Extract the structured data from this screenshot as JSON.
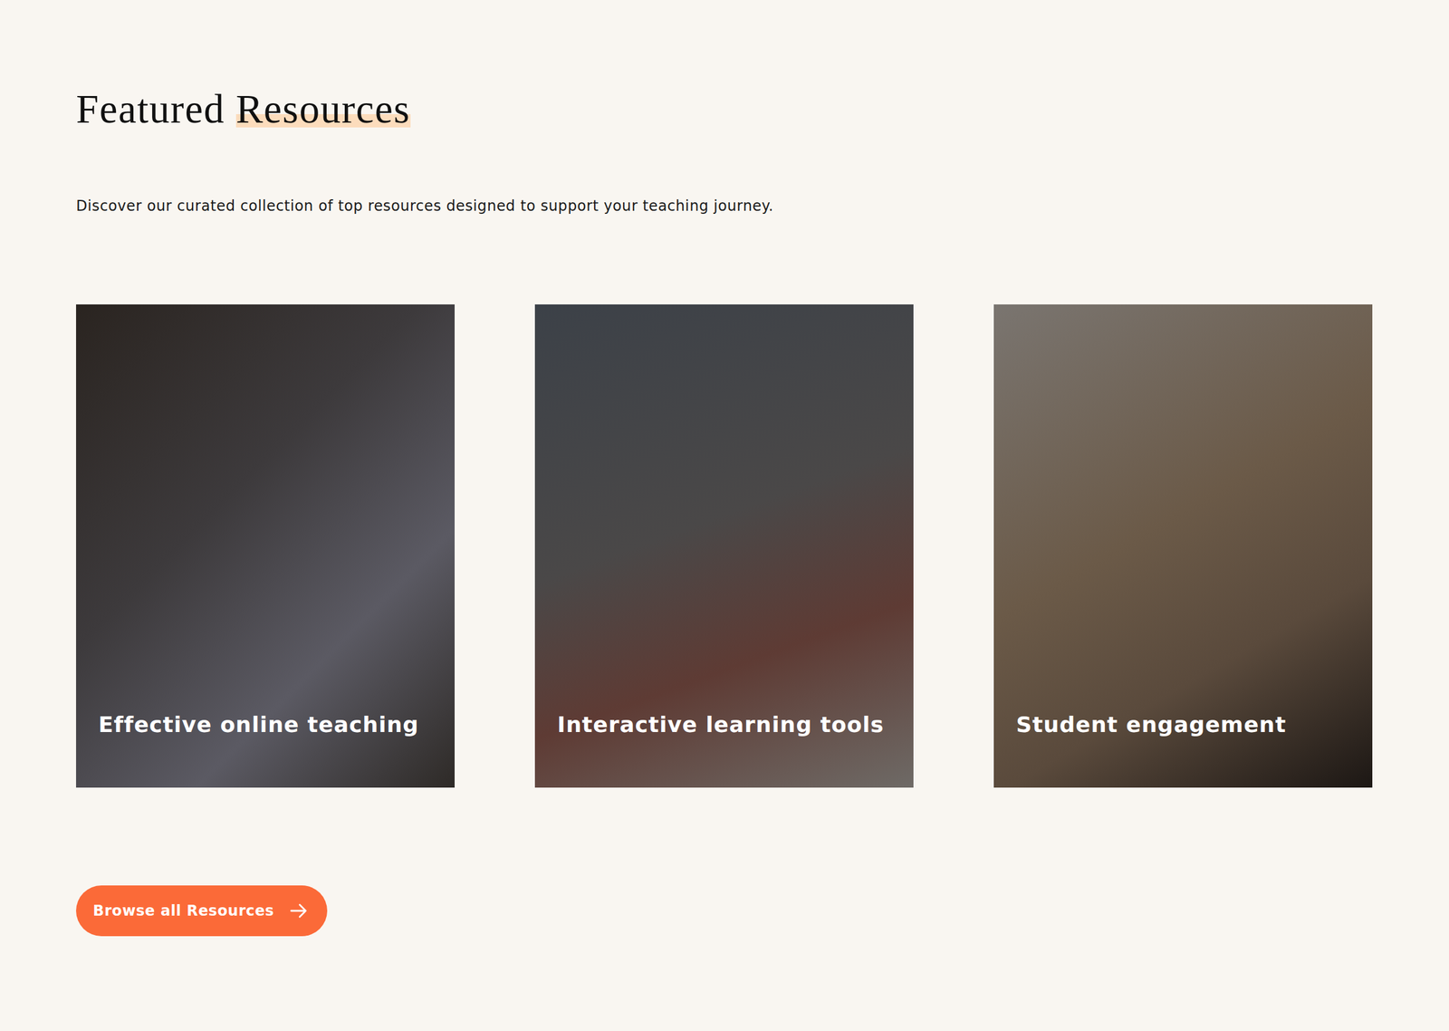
{
  "section": {
    "title": "Featured",
    "title_highlight": "Resources",
    "subtitle": "Discover our curated collection of top resources designed to support your teaching journey."
  },
  "cards": [
    {
      "title": "Effective online teaching"
    },
    {
      "title": "Interactive learning tools"
    },
    {
      "title": "Student engagement"
    }
  ],
  "button": {
    "label": "Browse all Resources"
  }
}
